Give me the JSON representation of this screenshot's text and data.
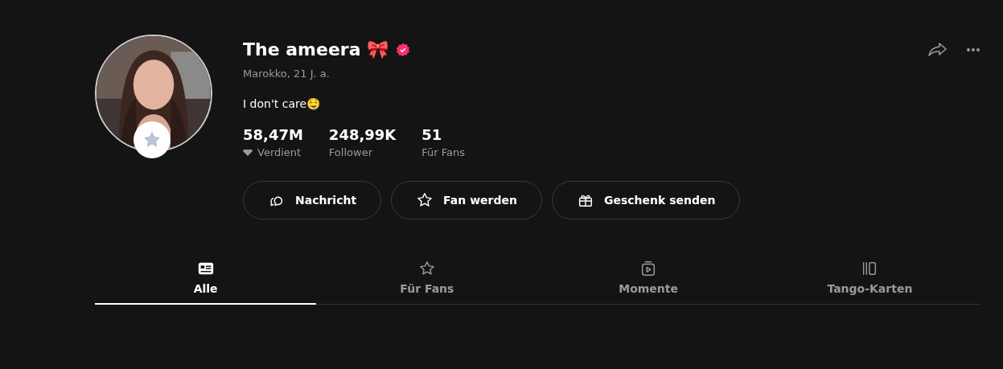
{
  "profile": {
    "name": "The ameera 🎀",
    "verified": true,
    "location": "Marokko, 21 J. a.",
    "bio": "I don't care🤤"
  },
  "stats": [
    {
      "value": "58,47M",
      "label": "Verdient",
      "kind": "earned"
    },
    {
      "value": "248,99K",
      "label": "Follower",
      "kind": "plain"
    },
    {
      "value": "51",
      "label": "Für Fans",
      "kind": "plain"
    }
  ],
  "buttons": [
    {
      "label": "Nachricht",
      "kind": "message"
    },
    {
      "label": "Fan werden",
      "kind": "star"
    },
    {
      "label": "Geschenk senden",
      "kind": "gift"
    }
  ],
  "tabs": [
    {
      "label": "Alle",
      "kind": "card",
      "selected": true
    },
    {
      "label": "Für Fans",
      "kind": "star",
      "selected": false
    },
    {
      "label": "Momente",
      "kind": "video",
      "selected": false
    },
    {
      "label": "Tango-Karten",
      "kind": "cards",
      "selected": false
    }
  ]
}
